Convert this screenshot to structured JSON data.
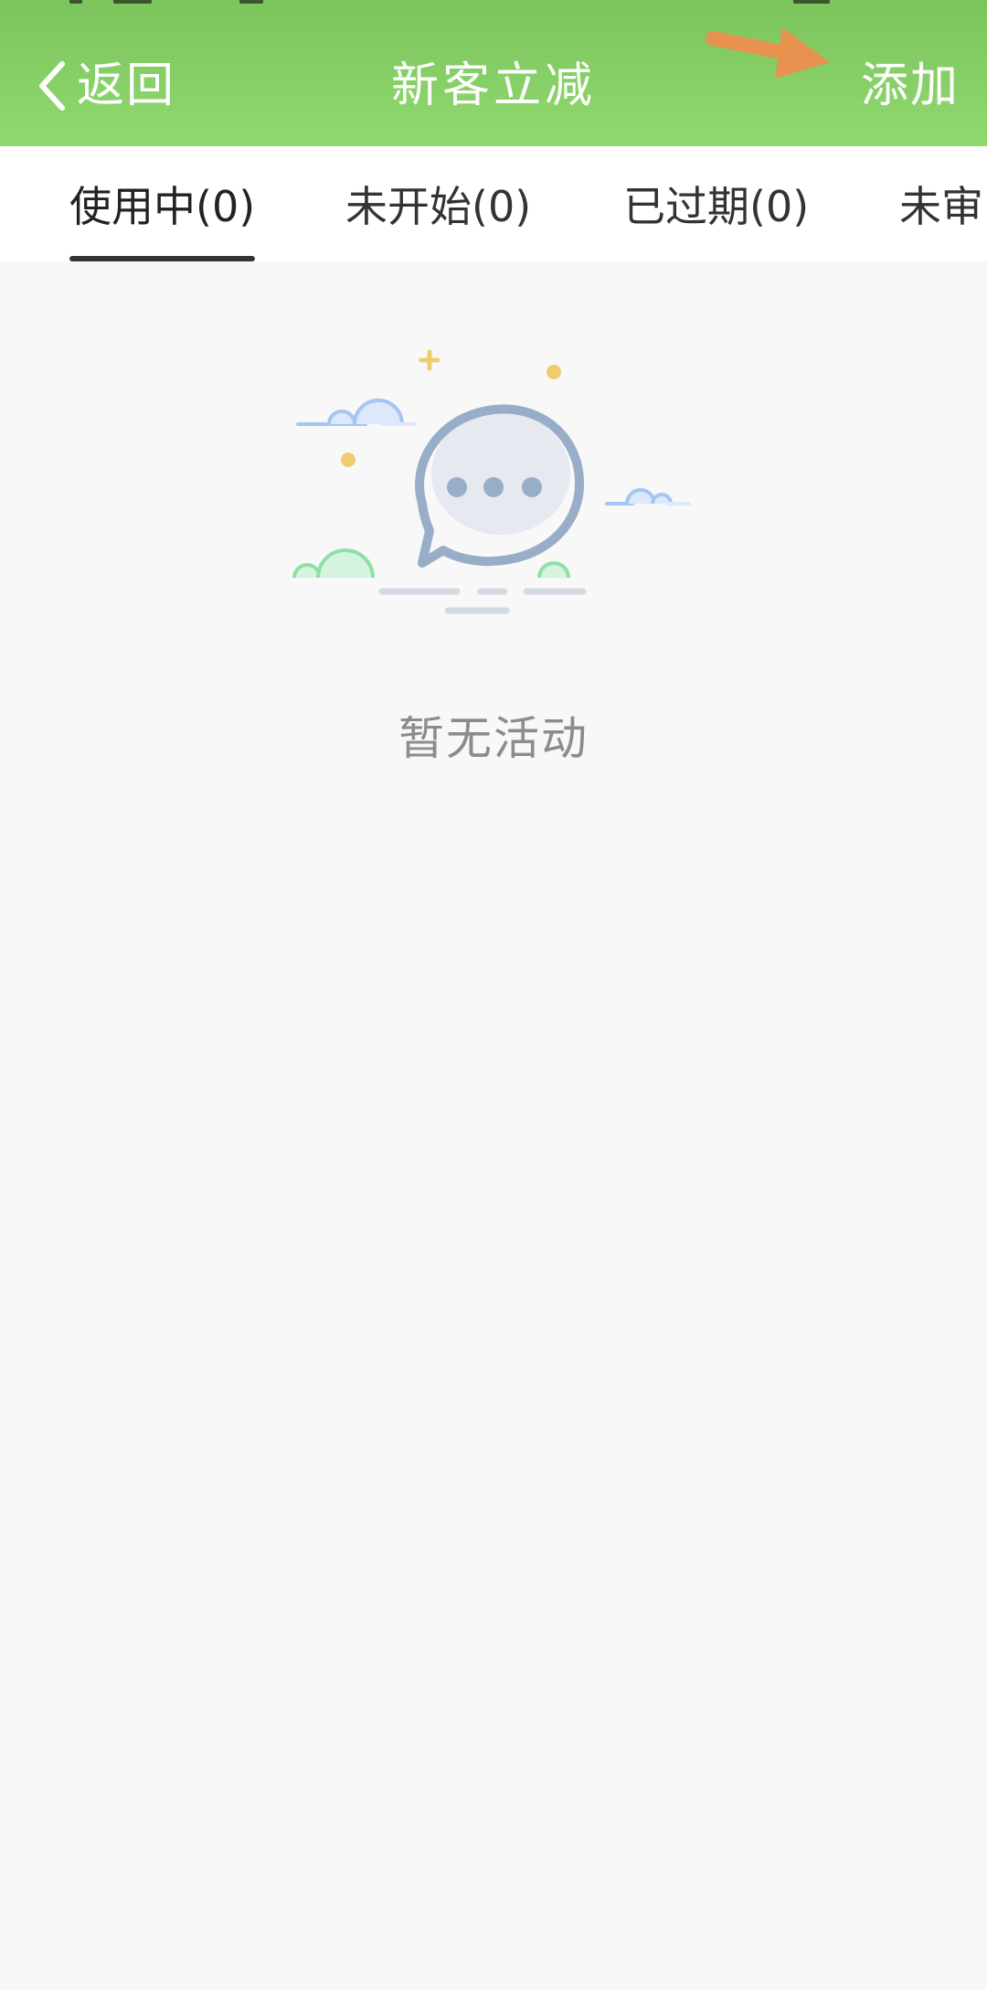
{
  "header": {
    "back_label": "返回",
    "title": "新客立减",
    "add_label": "添加",
    "background_color": "#8bd26c",
    "annotation_arrow_color": "#e8924f"
  },
  "tabs": [
    {
      "label": "使用中(0)",
      "active": true
    },
    {
      "label": "未开始(0)",
      "active": false
    },
    {
      "label": "已过期(0)",
      "active": false
    },
    {
      "label": "未审",
      "active": false
    }
  ],
  "empty_state": {
    "icon": "chat-bubble-icon",
    "message": "暂无活动"
  },
  "colors": {
    "page_background": "#f8f8f8",
    "text_primary": "#333333",
    "text_muted": "#8c8c8c"
  }
}
